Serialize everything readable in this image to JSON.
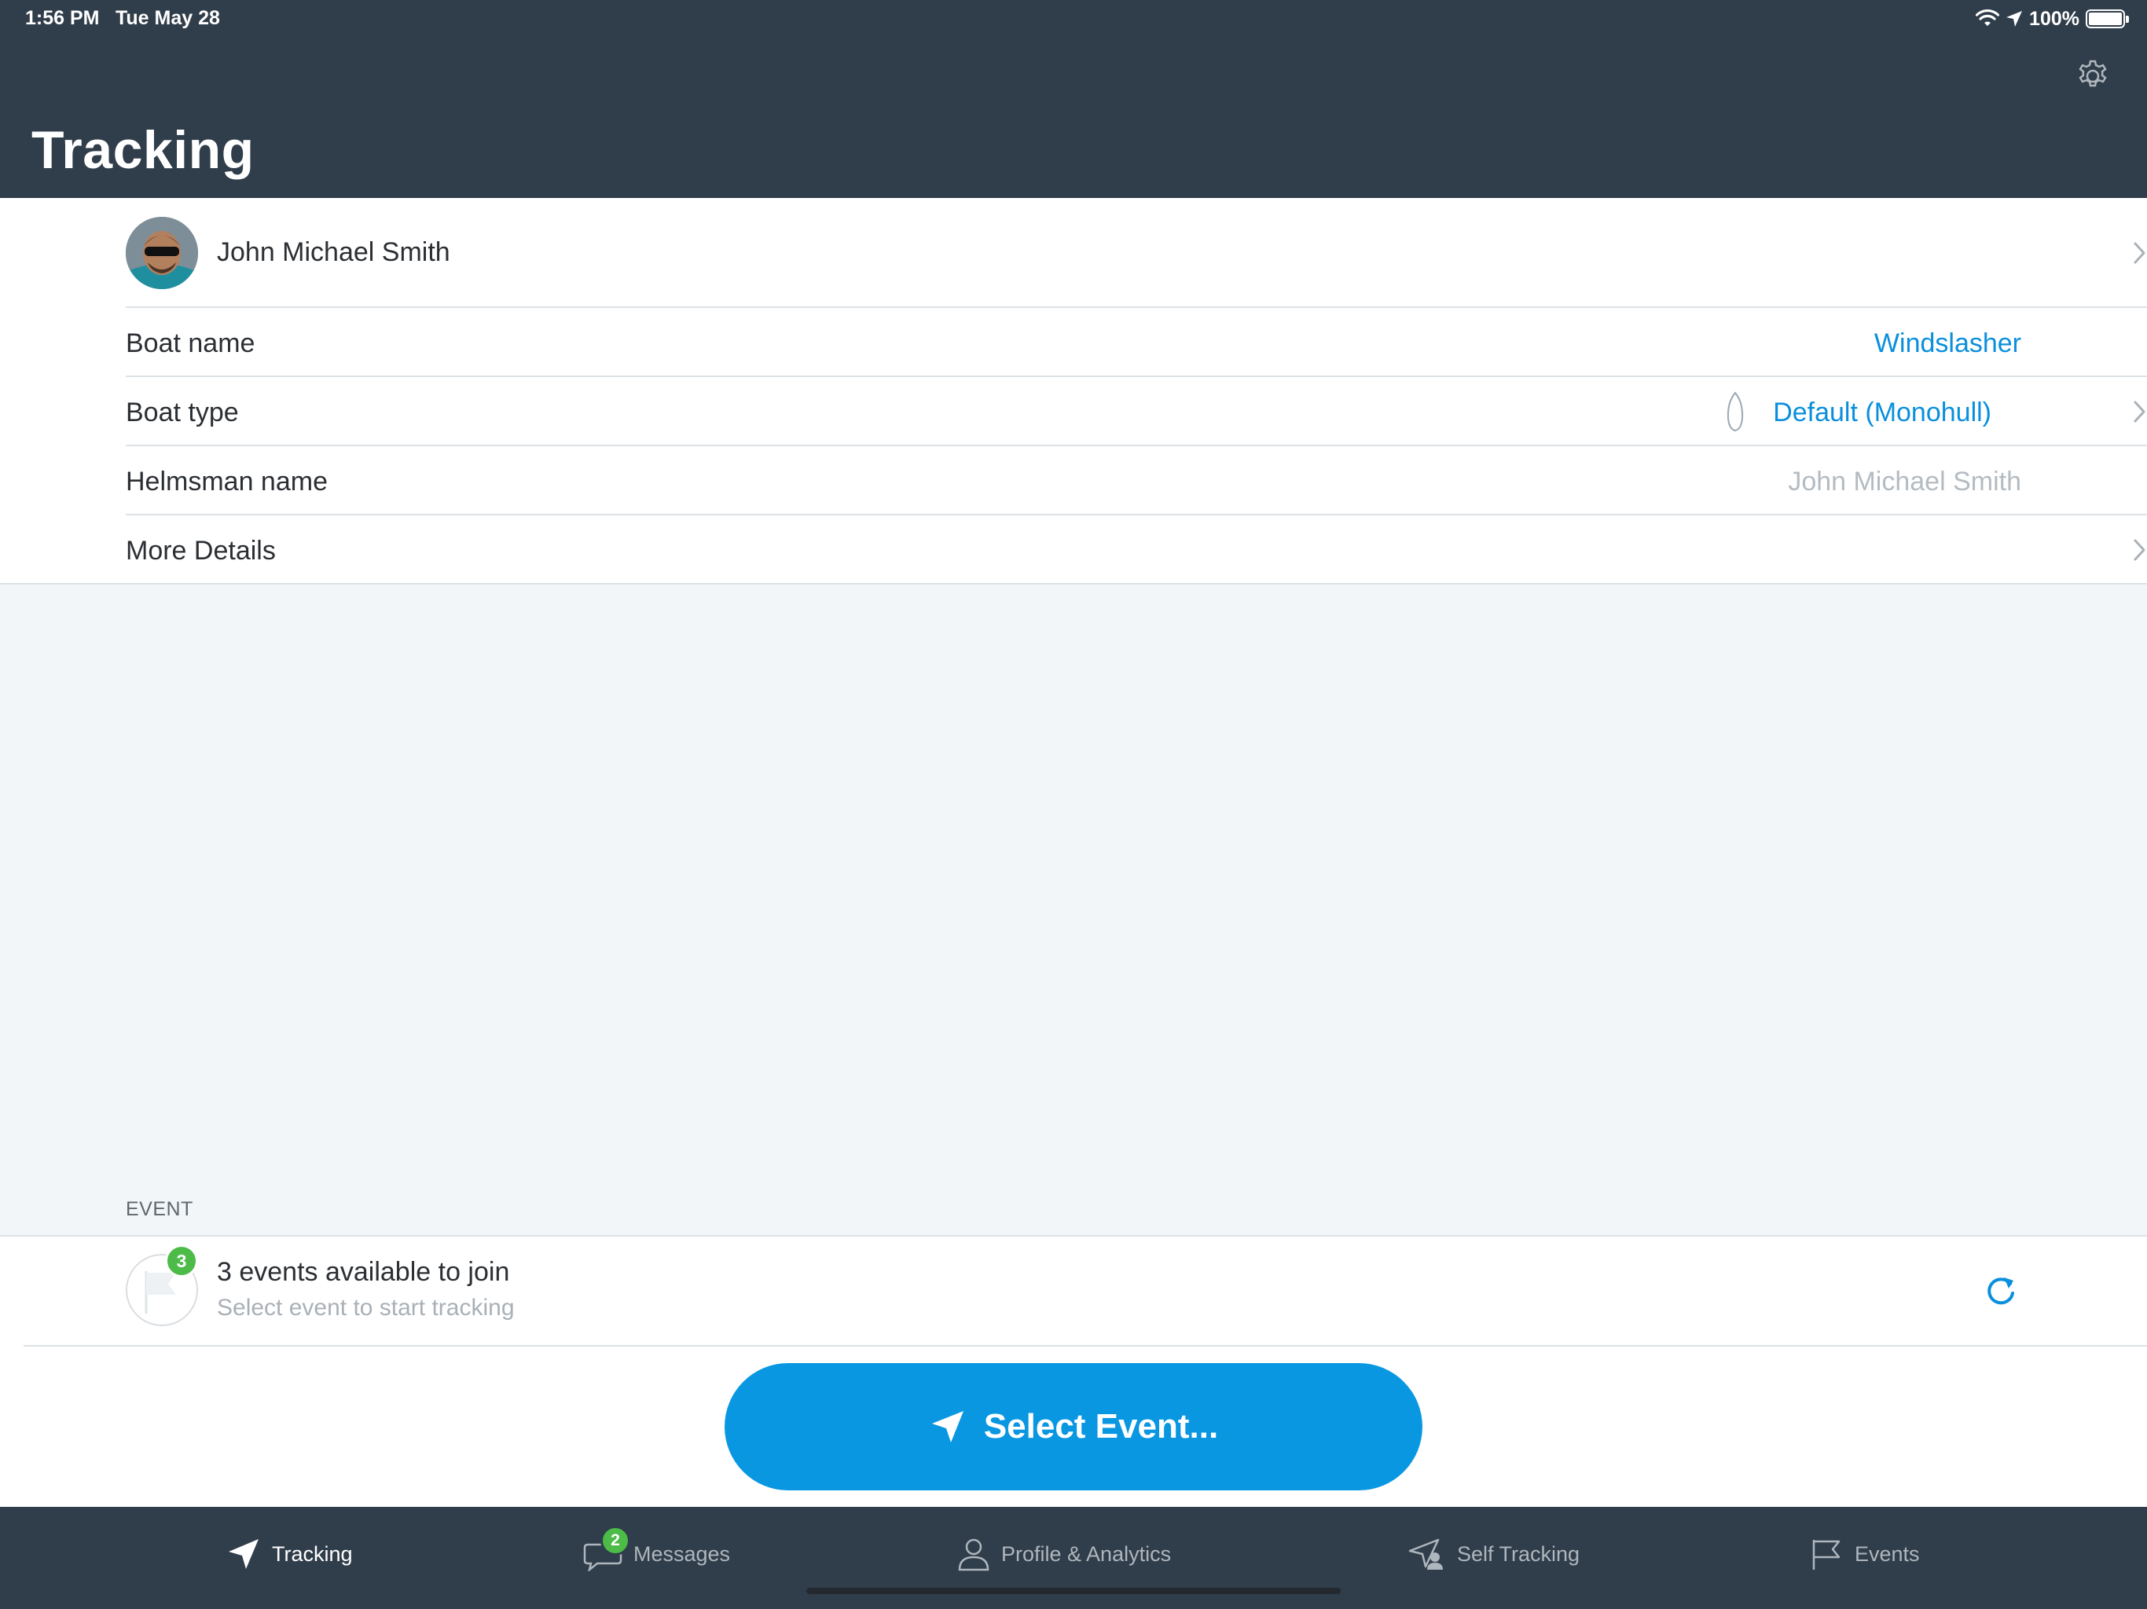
{
  "status_bar": {
    "time": "1:56 PM",
    "date": "Tue May 28",
    "battery": "100%"
  },
  "header": {
    "title": "Tracking"
  },
  "profile": {
    "name": "John Michael Smith"
  },
  "boat": {
    "name_label": "Boat name",
    "name_value": "Windslasher",
    "type_label": "Boat type",
    "type_value": "Default (Monohull)",
    "helmsman_label": "Helmsman name",
    "helmsman_placeholder": "John Michael Smith",
    "more_label": "More Details"
  },
  "event_section": {
    "header": "EVENT",
    "badge_count": "3",
    "title": "3 events available to join",
    "subtitle": "Select event to start tracking"
  },
  "primary_action": {
    "label": "Select Event..."
  },
  "tabbar": {
    "items": [
      {
        "label": "Tracking",
        "icon": "location-arrow-icon",
        "active": true
      },
      {
        "label": "Messages",
        "icon": "chat-bubble-icon",
        "badge": "2"
      },
      {
        "label": "Profile & Analytics",
        "icon": "person-icon"
      },
      {
        "label": "Self Tracking",
        "icon": "self-tracking-icon"
      },
      {
        "label": "Events",
        "icon": "flag-icon"
      }
    ]
  },
  "colors": {
    "header_bg": "#303d4a",
    "accent": "#0997e2",
    "badge": "#4cbb47",
    "page_bg": "#f3f6f9"
  }
}
